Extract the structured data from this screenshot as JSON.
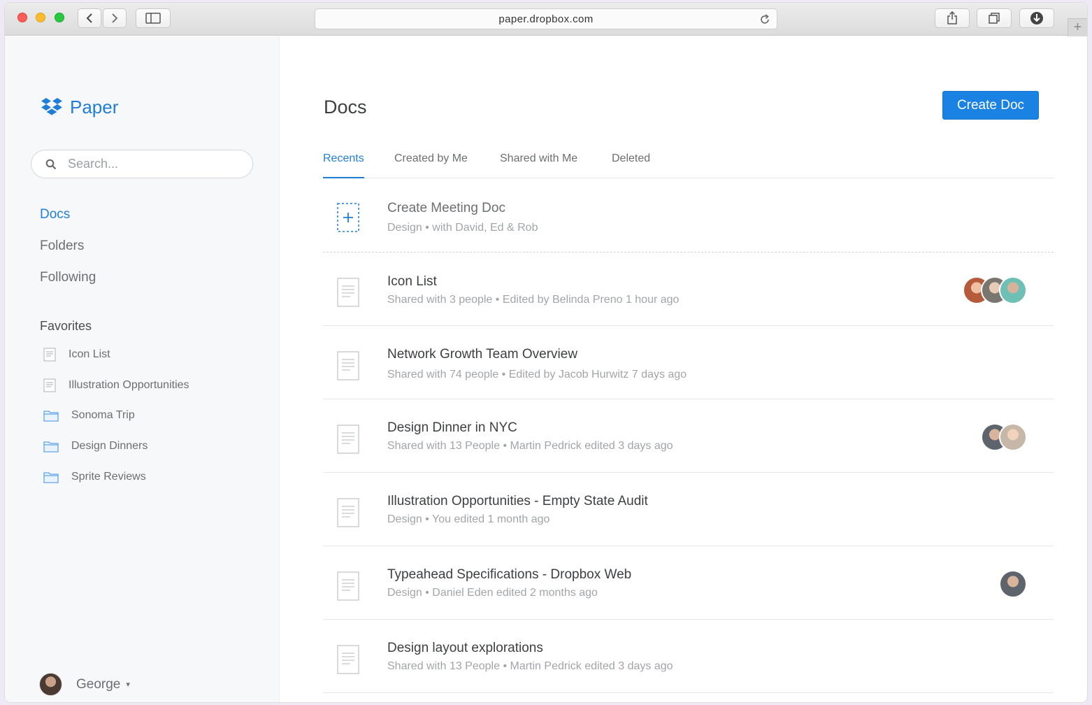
{
  "browser": {
    "url": "paper.dropbox.com",
    "new_tab_symbol": "+"
  },
  "brand": {
    "name": "Paper",
    "color": "#1f7fd8"
  },
  "search": {
    "placeholder": "Search..."
  },
  "nav": [
    {
      "label": "Docs",
      "active": true
    },
    {
      "label": "Folders",
      "active": false
    },
    {
      "label": "Following",
      "active": false
    }
  ],
  "favorites": {
    "title": "Favorites",
    "items": [
      {
        "label": "Icon List",
        "icon": "doc-icon"
      },
      {
        "label": "Illustration Opportunities",
        "icon": "doc-icon"
      },
      {
        "label": "Sonoma Trip",
        "icon": "folder-icon"
      },
      {
        "label": "Design Dinners",
        "icon": "folder-icon"
      },
      {
        "label": "Sprite Reviews",
        "icon": "folder-icon"
      }
    ]
  },
  "user": {
    "name": "George",
    "caret": "▾"
  },
  "main": {
    "title": "Docs",
    "create_label": "Create Doc",
    "accent": "#1a82e2",
    "tabs": [
      {
        "label": "Recents",
        "active": true
      },
      {
        "label": "Created by Me",
        "active": false
      },
      {
        "label": "Shared with Me",
        "active": false
      },
      {
        "label": "Deleted",
        "active": false
      }
    ],
    "meeting": {
      "title": "Create Meeting Doc",
      "subtitle": "Design • with David, Ed & Rob",
      "icon": "add-doc-icon"
    },
    "docs": [
      {
        "title": "Icon List",
        "subtitle": "Shared with 3 people • Edited by Belinda Preno 1 hour ago",
        "avatars": 3
      },
      {
        "title": "Network Growth Team Overview",
        "subtitle": "Shared with 74 people • Edited by Jacob Hurwitz 7 days ago",
        "avatars": 0
      },
      {
        "title": "Design Dinner in NYC",
        "subtitle": "Shared with 13 People • Martin Pedrick edited 3 days ago",
        "avatars": 2
      },
      {
        "title": "Illustration Opportunities - Empty State Audit",
        "subtitle": "Design • You edited 1 month ago",
        "avatars": 0
      },
      {
        "title": "Typeahead Specifications - Dropbox Web",
        "subtitle": "Design • Daniel Eden edited 2 months ago",
        "avatars": 1
      },
      {
        "title": "Design layout explorations",
        "subtitle": "Shared with 13 People • Martin Pedrick edited 3 days ago",
        "avatars": 0
      }
    ]
  }
}
